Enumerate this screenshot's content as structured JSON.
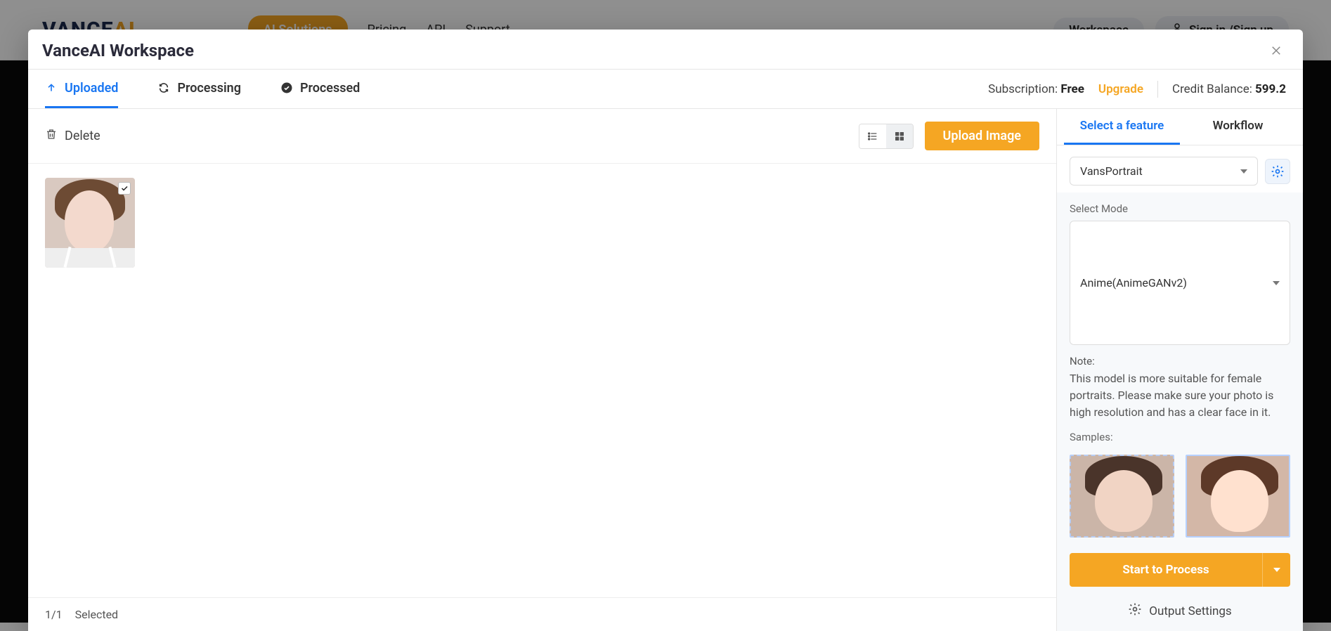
{
  "bg": {
    "logo1": "VANCE",
    "logo2": "AI",
    "nav": {
      "ai": "AI Solutions",
      "pricing": "Pricing",
      "api": "API",
      "support": "Support"
    },
    "workspace": "Workspace",
    "signin": "Sign in /Sign up"
  },
  "modal": {
    "title": "VanceAI Workspace"
  },
  "tabs": {
    "uploaded": "Uploaded",
    "processing": "Processing",
    "processed": "Processed"
  },
  "sub": {
    "label": "Subscription:",
    "value": "Free",
    "upgrade": "Upgrade",
    "balance_label": "Credit Balance:",
    "balance_value": "599.2"
  },
  "toolbar": {
    "delete": "Delete",
    "upload": "Upload Image"
  },
  "footer": {
    "count": "1/1",
    "selected": "Selected"
  },
  "right": {
    "tab_feature": "Select a feature",
    "tab_workflow": "Workflow",
    "model_selected": "VansPortrait",
    "mode_label": "Select Mode",
    "mode_selected": "Anime(AnimeGANv2)",
    "note_head": "Note:",
    "note_body": "This model is more suitable for female portraits. Please make sure your photo is high resolution and has a clear face in it.",
    "samples_label": "Samples:",
    "process": "Start to Process",
    "output_settings": "Output Settings"
  }
}
